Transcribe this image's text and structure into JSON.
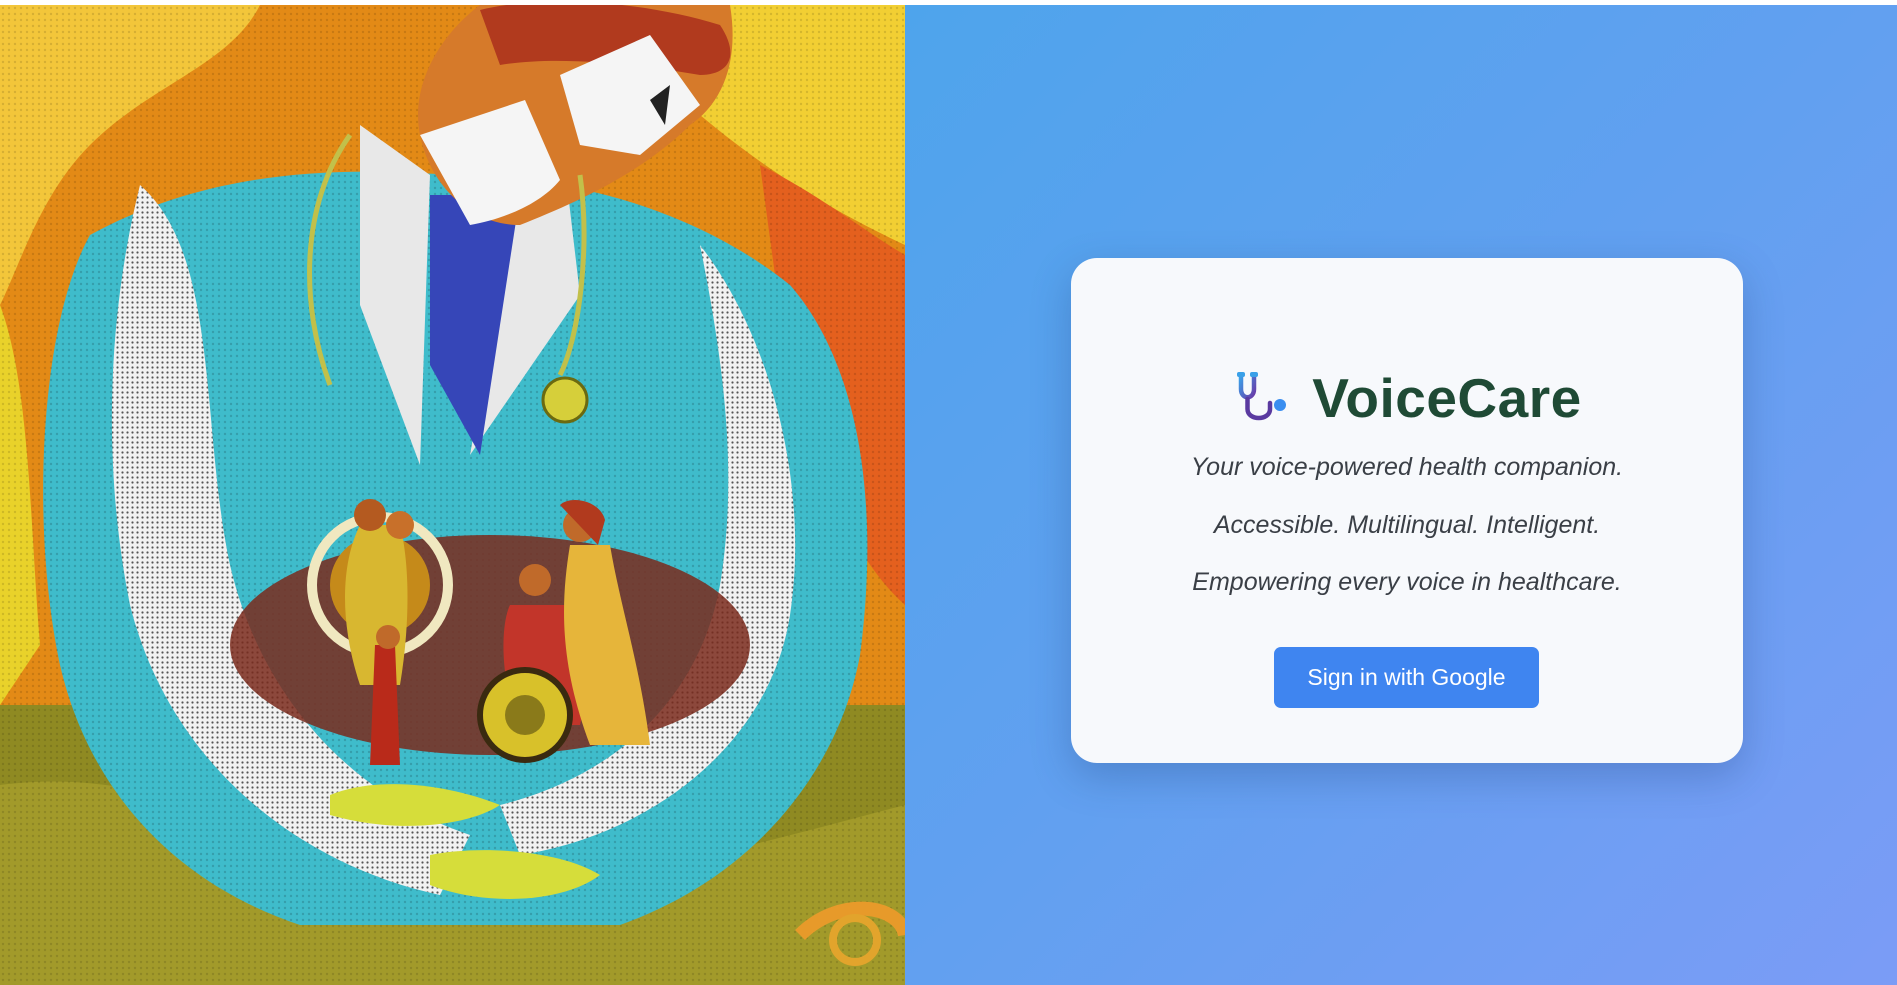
{
  "art": {
    "description_icon": "doctor-holding-family-illustration"
  },
  "brand": {
    "icon": "stethoscope-icon",
    "name": "VoiceCare"
  },
  "taglines": [
    "Your voice-powered health companion.",
    "Accessible. Multilingual. Intelligent.",
    "Empowering every voice in healthcare."
  ],
  "signin": {
    "label": "Sign in with Google"
  },
  "colors": {
    "gradient_start": "#4ea4ec",
    "gradient_end": "#7b9cf6",
    "card_bg": "#f7f9fc",
    "brand_text": "#1f4a35",
    "button_bg": "#3f85f0"
  }
}
